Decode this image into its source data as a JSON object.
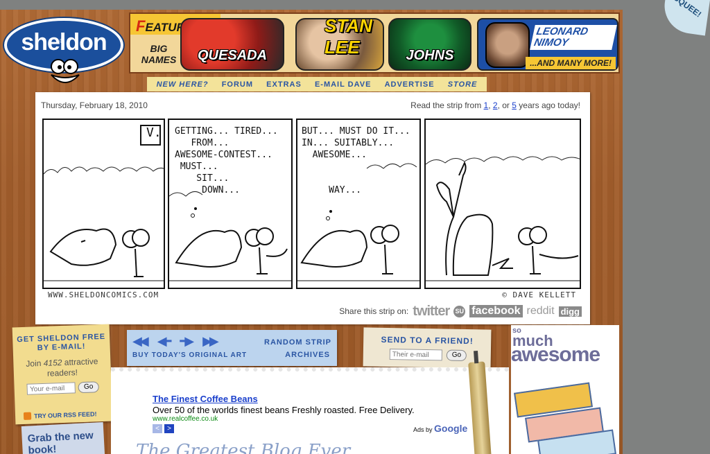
{
  "logo": {
    "text": "sheldon",
    "reg": "®"
  },
  "squee": "SQUEE!",
  "banner": {
    "featuring": "EATURING...",
    "featuring_first": "F",
    "bignames": "BIG NAMES",
    "names": [
      "QUESADA",
      "STAN LEE",
      "JOHNS",
      "LEONARD NIMOY"
    ],
    "more": "...AND MANY MORE!"
  },
  "nav": [
    "NEW HERE?",
    "FORUM",
    "EXTRAS",
    "E-MAIL DAVE",
    "ADVERTISE",
    "STORE"
  ],
  "comic": {
    "date": "Thursday, February 18, 2010",
    "readfrom_prefix": "Read the strip from ",
    "years": [
      "1",
      "2",
      "5"
    ],
    "readfrom_sep1": ", ",
    "readfrom_sep2": ", or ",
    "readfrom_suffix": " years ago today!",
    "panel1_sig": "V.",
    "panel2_text": "GETTING... TIRED...\n   FROM...\nAWESOME-CONTEST...\n MUST...\n    SIT...\n     DOWN...",
    "panel3_text": "BUT... MUST DO IT...\nIN... SUITABLY...\n  AWESOME...\n\n\n     WAY...",
    "site": "WWW.SHELDONCOMICS.COM",
    "copyright": "© DAVE KELLETT",
    "share_label": "Share this strip on:",
    "share": [
      "twitter",
      "SU",
      "facebook",
      "reddit",
      "digg"
    ]
  },
  "signup": {
    "heading": "GET SHELDON FREE BY E-MAIL!",
    "join_prefix": "Join ",
    "count": "4152",
    "join_suffix": " attractive readers!",
    "email_placeholder": "Your e-mail",
    "go": "Go",
    "rss": "TRY OUR RSS FEED!"
  },
  "book": {
    "text": "Grab the new book!"
  },
  "archive": {
    "buy": "BUY TODAY'S ORIGINAL ART",
    "random": "RANDOM STRIP",
    "archives": "ARCHIVES"
  },
  "send": {
    "heading": "SEND TO A FRIEND!",
    "email_placeholder": "Their e-mail",
    "go": "Go"
  },
  "ad": {
    "title": "The Finest Coffee Beans",
    "text": "Over 50 of the worlds finest beans Freshly roasted. Free Delivery.",
    "url": "www.realcoffee.co.uk",
    "adsby": "Ads by",
    "google": "Google"
  },
  "blog": {
    "title": "The Greatest Blog Ever"
  },
  "awesome": {
    "so": "so",
    "much": "much",
    "awesome": "awesome"
  },
  "colors": {
    "link": "#1a3fcc",
    "nav": "#2a55a3",
    "wood": "#a15d2b"
  }
}
